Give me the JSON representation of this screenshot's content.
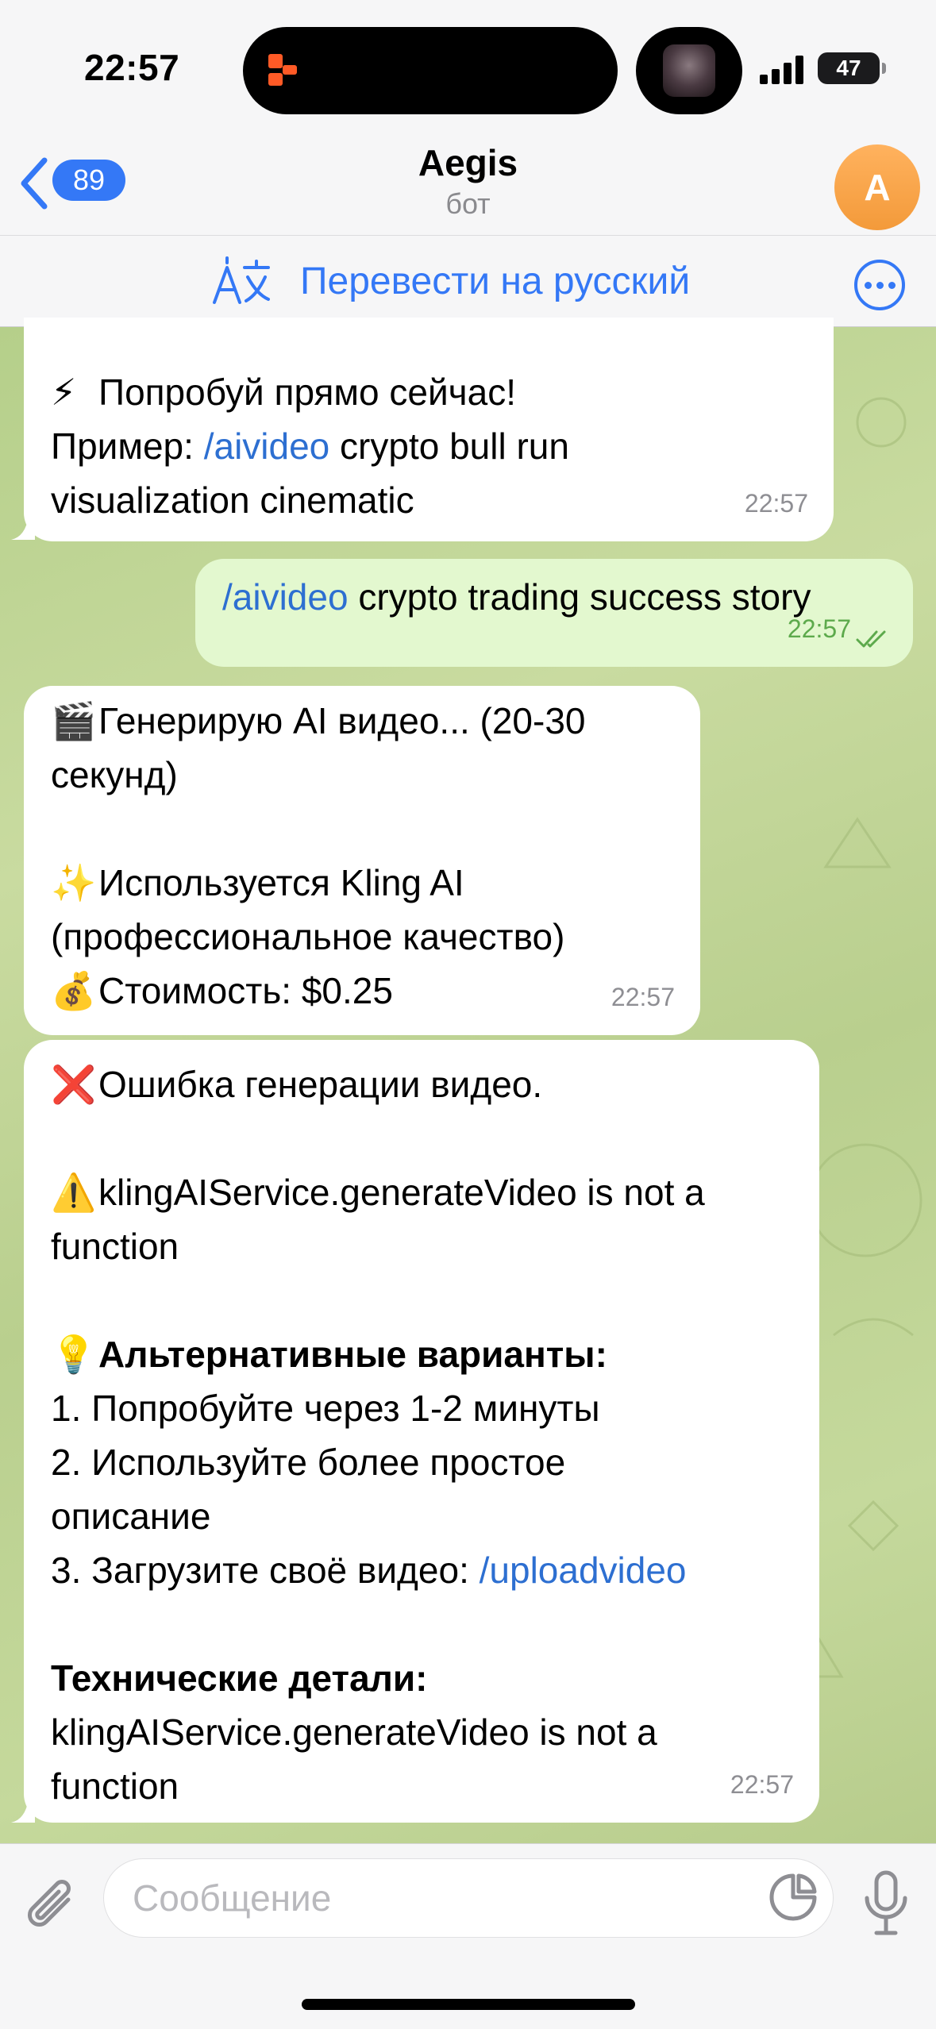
{
  "status_bar": {
    "time": "22:57",
    "battery": "47"
  },
  "header": {
    "back_count": "89",
    "title": "Aegis",
    "subtitle": "бот",
    "avatar_letter": "A"
  },
  "translate_bar": {
    "label": "Перевести на русский"
  },
  "messages": [
    {
      "direction": "in",
      "lines": [
        {
          "emoji": "⚡",
          "text": "Попробуй прямо сейчас!"
        },
        {
          "prefix": "Пример: ",
          "cmd": "/aivideo",
          "text": " crypto bull run"
        },
        {
          "text": "visualization cinematic"
        }
      ],
      "time": "22:57"
    },
    {
      "direction": "out",
      "lines": [
        {
          "cmd": "/aivideo",
          "text": " crypto trading success story"
        }
      ],
      "time": "22:57"
    },
    {
      "direction": "in",
      "lines": [
        {
          "emoji": "🎬",
          "text": "Генерирую AI видео... (20-30"
        },
        {
          "text": "секунд)"
        },
        {
          "text": ""
        },
        {
          "emoji": "✨",
          "text": "Используется Kling AI"
        },
        {
          "text": "(профессиональное качество)"
        },
        {
          "emoji": "💰",
          "text": "Стоимость: $0.25"
        }
      ],
      "time": "22:57"
    },
    {
      "direction": "in",
      "lines": [
        {
          "emoji": "❌",
          "text": "Ошибка генерации видео."
        },
        {
          "text": ""
        },
        {
          "emoji": "⚠️",
          "text": "klingAIService.generateVideo is not a"
        },
        {
          "text": "function"
        },
        {
          "text": ""
        },
        {
          "emoji": "💡",
          "bold": "Альтернативные варианты:"
        },
        {
          "text": "1. Попробуйте через 1-2 минуты"
        },
        {
          "text": "2. Используйте более простое"
        },
        {
          "text": "описание"
        },
        {
          "prefix": "3. Загрузите своё видео: ",
          "cmd": "/uploadvideo"
        },
        {
          "text": ""
        },
        {
          "bold": "Технические детали:"
        },
        {
          "text": "klingAIService.generateVideo is not a"
        },
        {
          "text": "function"
        }
      ],
      "time": "22:57"
    }
  ],
  "input": {
    "placeholder": "Сообщение"
  },
  "icons": {
    "back": "chevron-left-icon",
    "translate": "translate-icon",
    "more": "more-icon",
    "attach": "paperclip-icon",
    "sticker": "sticker-icon",
    "mic": "microphone-icon"
  },
  "colors": {
    "accent": "#3478f6",
    "outgoing_bubble": "#e3f8cf",
    "link": "#2d6fd1",
    "avatar": "#f5a14a"
  }
}
